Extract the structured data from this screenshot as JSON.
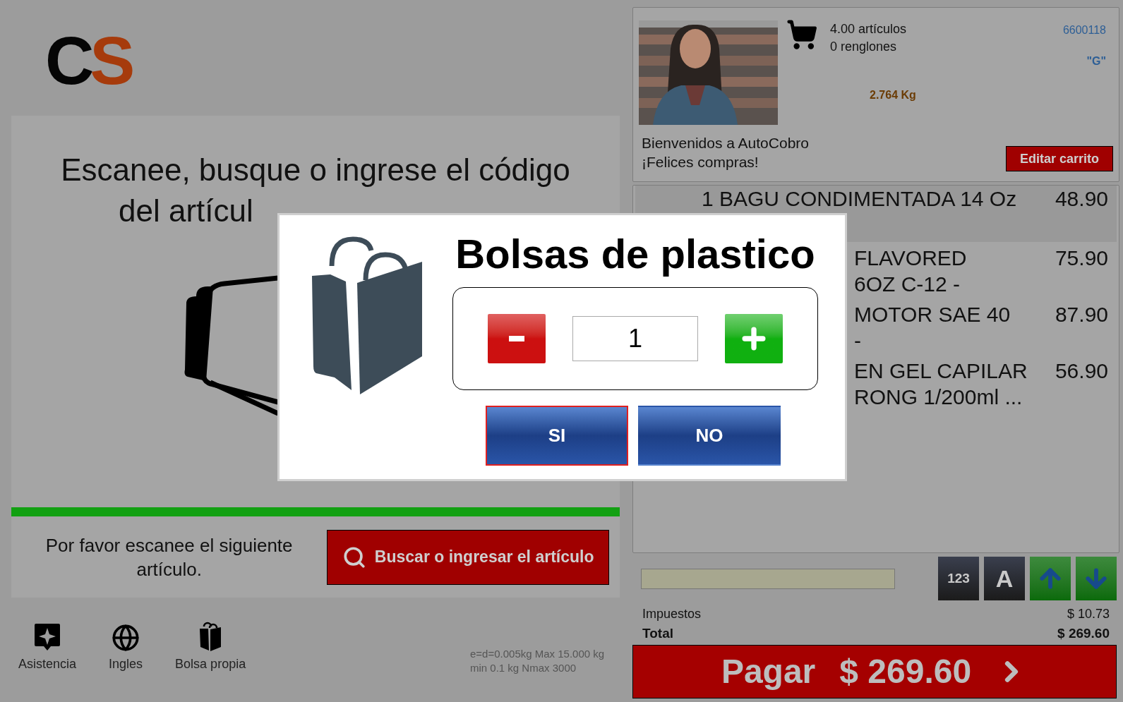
{
  "logo": "CS",
  "prompt": {
    "lines": [
      "Escanee, busque o ingrese el código",
      "del artícul"
    ]
  },
  "progress": {
    "level": 1
  },
  "scan_hint": "Por favor escanee el siguiente artículo.",
  "search_button": "Buscar o ingresar el artículo",
  "toolbar": [
    {
      "kind": "assist",
      "label": "Asistencia"
    },
    {
      "kind": "language",
      "label": "Ingles"
    },
    {
      "kind": "bag",
      "label": "Bolsa propia"
    }
  ],
  "scale_info": "e=d=0.005kg Max 15.000 kg min 0.1 kg Nmax 3000",
  "cart": {
    "items_count": "4.00 artículos",
    "lines_count": "0 renglones",
    "store_id": "6600118",
    "lane": "\"G\"",
    "weight": "2.764 Kg",
    "welcome": [
      "Bienvenidos a AutoCobro",
      "¡Felices compras!"
    ],
    "edit_button": "Editar carrito"
  },
  "items": [
    {
      "name_lines": [
        "1 BAGU CONDIMENTADA 14 Oz"
      ],
      "price": "48.90",
      "selected": true,
      "clipped": false
    },
    {
      "name_lines": [
        "FLAVORED",
        "6OZ C-12 -"
      ],
      "price": "75.90",
      "selected": false,
      "clipped": true
    },
    {
      "name_lines": [
        "MOTOR SAE 40",
        "-"
      ],
      "price": "87.90",
      "selected": false,
      "clipped": true
    },
    {
      "name_lines": [
        "EN GEL CAPILAR",
        "RONG 1/200ml ..."
      ],
      "price": "56.90",
      "selected": false,
      "clipped": true
    }
  ],
  "keys": [
    {
      "kind": "text",
      "label": "123"
    },
    {
      "kind": "text",
      "label": "A"
    },
    {
      "kind": "up"
    },
    {
      "kind": "down"
    }
  ],
  "summary": {
    "tax_label": "Impuestos",
    "tax": "$ 10.73",
    "total_label": "Total",
    "total": "$ 269.60"
  },
  "pay_button": {
    "label": "Pagar",
    "amount": "$ 269.60"
  },
  "dialog": {
    "title": "Bolsas de plastico",
    "value": "1",
    "buttons": [
      {
        "label": "SI",
        "selected": true
      },
      {
        "label": "NO",
        "selected": false
      }
    ]
  }
}
